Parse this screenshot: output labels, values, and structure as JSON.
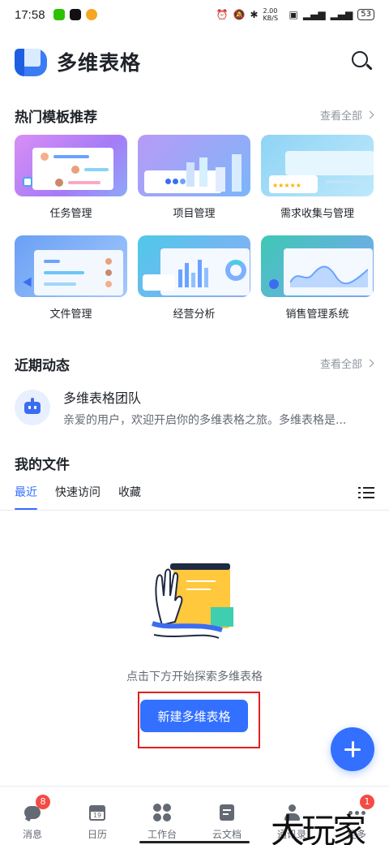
{
  "status_bar": {
    "time": "17:58",
    "network_speed": "2.00 KB/S",
    "battery": "53"
  },
  "header": {
    "title": "多维表格"
  },
  "templates_section": {
    "title": "热门模板推荐",
    "view_all": "查看全部",
    "items": [
      {
        "label": "任务管理"
      },
      {
        "label": "项目管理"
      },
      {
        "label": "需求收集与管理"
      },
      {
        "label": "文件管理"
      },
      {
        "label": "经营分析"
      },
      {
        "label": "销售管理系统"
      }
    ]
  },
  "recent_section": {
    "title": "近期动态",
    "view_all": "查看全部",
    "item": {
      "name": "多维表格团队",
      "description": "亲爱的用户，欢迎开启你的多维表格之旅。多维表格是..."
    }
  },
  "files_section": {
    "title": "我的文件",
    "tabs": [
      "最近",
      "快速访问",
      "收藏"
    ],
    "active_tab": "最近",
    "empty_text": "点击下方开始探索多维表格",
    "create_button": "新建多维表格"
  },
  "bottom_nav": {
    "items": [
      {
        "label": "消息",
        "icon": "chat-bubble-icon",
        "badge": "8"
      },
      {
        "label": "日历",
        "icon": "calendar-icon",
        "day": "19"
      },
      {
        "label": "工作台",
        "icon": "grid-icon"
      },
      {
        "label": "云文档",
        "icon": "document-icon"
      },
      {
        "label": "通讯录",
        "icon": "contacts-icon"
      },
      {
        "label": "更多",
        "icon": "more-icon",
        "badge": "1"
      }
    ]
  },
  "watermark": "大玩家",
  "colors": {
    "accent": "#3370ff",
    "badge": "#f54a45",
    "highlight_box": "#e02020"
  }
}
